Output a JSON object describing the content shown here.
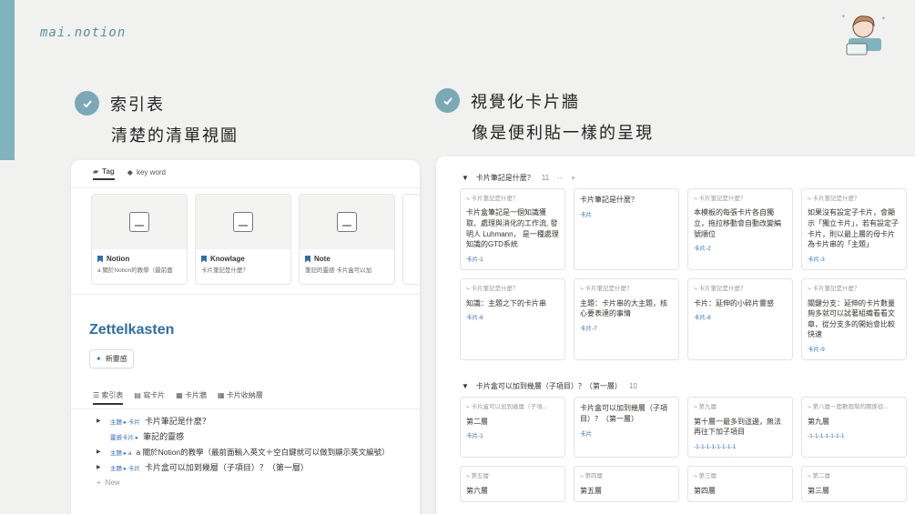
{
  "brand": "mai.notion",
  "features": [
    {
      "title": "索引表",
      "subtitle": "清楚的清單視圖"
    },
    {
      "title": "視覺化卡片牆",
      "subtitle": "像是便利貼一樣的呈現"
    }
  ],
  "left_panel": {
    "tabs": [
      "Tag",
      "key word"
    ],
    "gallery": [
      {
        "title": "Notion",
        "sub": "a 關於Notion的教學（最前面"
      },
      {
        "title": "Knowlage",
        "sub": "卡片筆記是什麼？"
      },
      {
        "title": "Note",
        "sub": "筆記的靈感  卡片盒可以加"
      }
    ],
    "db_title": "Zettelkasten",
    "new_button": "新靈感",
    "view_tabs": [
      "索引表",
      "寫卡片",
      "卡片牆",
      "卡片收納層"
    ],
    "items": [
      {
        "crumb": "主題 ▸ 卡片",
        "text": "卡片筆記是什麼？"
      },
      {
        "crumb": "靈感卡片 ▸",
        "text": "筆記的靈感"
      },
      {
        "crumb": "主題 ▸ a",
        "text": "a 關於Notion的教學（最前面輸入英文＋空白鍵就可以做到顯示英文編號）"
      },
      {
        "crumb": "主題 ▸ 卡片",
        "text": "卡片盒可以加到幾層（子項目）？（第一層）"
      }
    ],
    "new_row": "New"
  },
  "right_panel": {
    "groups": [
      {
        "title": "卡片筆記是什麼？",
        "count": "11",
        "rows": [
          [
            {
              "label": "卡片筆記是什麼？",
              "body": "卡片盒筆記是一個知識獲取、處理與消化的工作流, 發明人 Luhmann， 是一種處理知識的GTD系統",
              "tag": "卡片-1"
            },
            {
              "label": "",
              "body": "卡片筆記是什麼？",
              "tag": "卡片"
            },
            {
              "label": "卡片筆記是什麼？",
              "body": "本模板的每張卡片各自獨立，拖拉移動會自動改變編號順位",
              "tag": "卡片-2"
            },
            {
              "label": "卡片筆記是什麼？",
              "body": "如果沒有設定子卡片，會顯示「獨立卡片」，若有設定子卡片，則以最上層的母卡片為卡片串的「主題」",
              "tag": "卡片-3"
            }
          ],
          [
            {
              "label": "卡片筆記是什麼？",
              "body": "知識：主題之下的卡片串",
              "tag": "卡片-6"
            },
            {
              "label": "卡片筆記是什麼？",
              "body": "主題：卡片串的大主題，核心要表達的事情",
              "tag": "卡片-7"
            },
            {
              "label": "卡片筆記是什麼？",
              "body": "卡片：延伸的小碎片靈感",
              "tag": "卡片-8"
            },
            {
              "label": "卡片筆記是什麼？",
              "body": "關鍵分支：延伸的卡片數量夠多就可以試著組織看看文章，從分支多的開始會比較快速",
              "tag": "卡片-9"
            }
          ]
        ]
      },
      {
        "title": "卡片盒可以加到幾層（子項目）？（第一層）",
        "count": "10",
        "rows": [
          [
            {
              "label": "卡片盒可以加到幾層（子項...",
              "body": "第二層",
              "tag": "卡片-1"
            },
            {
              "label": "",
              "body": "卡片盒可以加到幾層（子項目）？（第一層）",
              "tag": "卡片"
            },
            {
              "label": "第九層",
              "body": "第十層一最多到這邊，無法再往下加子項目",
              "tag": "-1-1-1-1-1-1-1-1"
            },
            {
              "label": "第八層一面數限制的關係從...",
              "body": "第九層",
              "tag": "-1-1-1-1-1-1-1"
            }
          ],
          [
            {
              "label": "第五層",
              "body": "第六層",
              "tag": ""
            },
            {
              "label": "第四層",
              "body": "第五層",
              "tag": ""
            },
            {
              "label": "第三層",
              "body": "第四層",
              "tag": ""
            },
            {
              "label": "第二層",
              "body": "第三層",
              "tag": ""
            }
          ]
        ]
      }
    ]
  }
}
